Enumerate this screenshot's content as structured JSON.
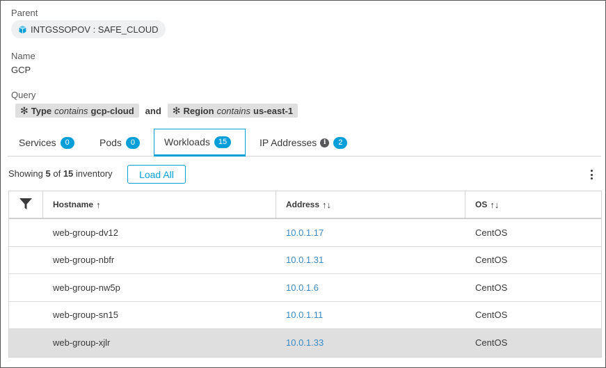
{
  "parent": {
    "label": "Parent",
    "value": "INTGSSOPOV : SAFE_CLOUD",
    "icon": "cube-icon"
  },
  "name": {
    "label": "Name",
    "value": "GCP"
  },
  "query": {
    "label": "Query",
    "conditions": [
      {
        "field": "Type",
        "operator": "contains",
        "value": "gcp-cloud"
      },
      {
        "field": "Region",
        "operator": "contains",
        "value": "us-east-1"
      }
    ],
    "conjunction": "and"
  },
  "tabs": [
    {
      "label": "Services",
      "count": "0",
      "active": false
    },
    {
      "label": "Pods",
      "count": "0",
      "active": false
    },
    {
      "label": "Workloads",
      "count": "15",
      "active": true
    },
    {
      "label": "IP Addresses",
      "count": "2",
      "active": false,
      "info_icon": "info-icon"
    }
  ],
  "summary": {
    "prefix": "Showing",
    "shown": "5",
    "of": "of",
    "total": "15",
    "suffix": "inventory"
  },
  "load_all_label": "Load All",
  "table": {
    "columns": [
      {
        "label": "",
        "icon": "filter-icon"
      },
      {
        "label": "Hostname",
        "sort": "↑"
      },
      {
        "label": "Address",
        "sort": "↑↓"
      },
      {
        "label": "OS",
        "sort": "↑↓"
      }
    ],
    "rows": [
      {
        "hostname": "web-group-dv12",
        "address": "10.0.1.17",
        "os": "CentOS"
      },
      {
        "hostname": "web-group-nbfr",
        "address": "10.0.1.31",
        "os": "CentOS"
      },
      {
        "hostname": "web-group-nw5p",
        "address": "10.0.1.6",
        "os": "CentOS"
      },
      {
        "hostname": "web-group-sn15",
        "address": "10.0.1.11",
        "os": "CentOS"
      },
      {
        "hostname": "web-group-xjlr",
        "address": "10.0.1.33",
        "os": "CentOS",
        "selected": true
      }
    ]
  },
  "colors": {
    "accent": "#049fd9",
    "link": "#3a8bc5",
    "selected_row": "#dfdfdf"
  }
}
